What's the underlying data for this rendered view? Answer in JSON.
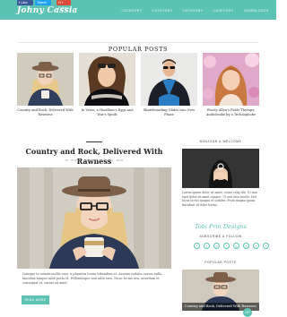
{
  "header": {
    "social_buttons": [
      "f Like",
      "Tweet",
      "G+ Follow"
    ],
    "logo": "Johny Cassia",
    "nav": [
      "CATEGORY",
      "CATEGORY",
      "CATEGORY",
      "CATEGORY",
      "DOWNLOADS"
    ]
  },
  "popular": {
    "title": "POPULAR POSTS",
    "items": [
      {
        "caption": "Country and Rock, Delivered With Rawness"
      },
      {
        "caption": "In Verse, a Hoodlum's Eggs and War's Spoils"
      },
      {
        "caption": "Skateboarding Glides Into New Phase"
      },
      {
        "caption": "Woody Allen's Fable Therapy: Audiobooks by a Technophobe"
      }
    ]
  },
  "post": {
    "title": "Country and Rock, Delivered With Rawness",
    "meta": "BY JOHNNY CASSIA · UNCATEG · MAR",
    "excerpt": "Quisque to ornare mollis eros, a pharetra lorem bibendum et. Aenean sodales varius nulla, faucibus tempor nibh porta id. Pellentesque non nibh eros. Nunc lectus nisi, interdum et consequat et, varius sit amet.",
    "read_more": "READ MORE"
  },
  "sidebar": {
    "about_title": "BONJOUR & WELCOME",
    "about_text": "Lorem ipsum dolor sit amet, conse sclig elit. Ut mia eget dolor sit amet congue. Ut nisi eros morbi. Sed lacus lectus magna et sodales. Proin magna quam, tincidunt id dolor lorem.",
    "signature": "Tobi Prin Designs",
    "subscribe_title": "SUBSCRIBE & FOLLOW",
    "social_icons": [
      "f",
      "t",
      "p",
      "i",
      "g",
      "b",
      "o",
      "r"
    ],
    "popular_title": "POPULAR POSTS",
    "popular_caption": "Country and Rock, Delivered With Rawness",
    "scroll_label": "UP"
  },
  "colors": {
    "accent": "#5cc2b4"
  }
}
